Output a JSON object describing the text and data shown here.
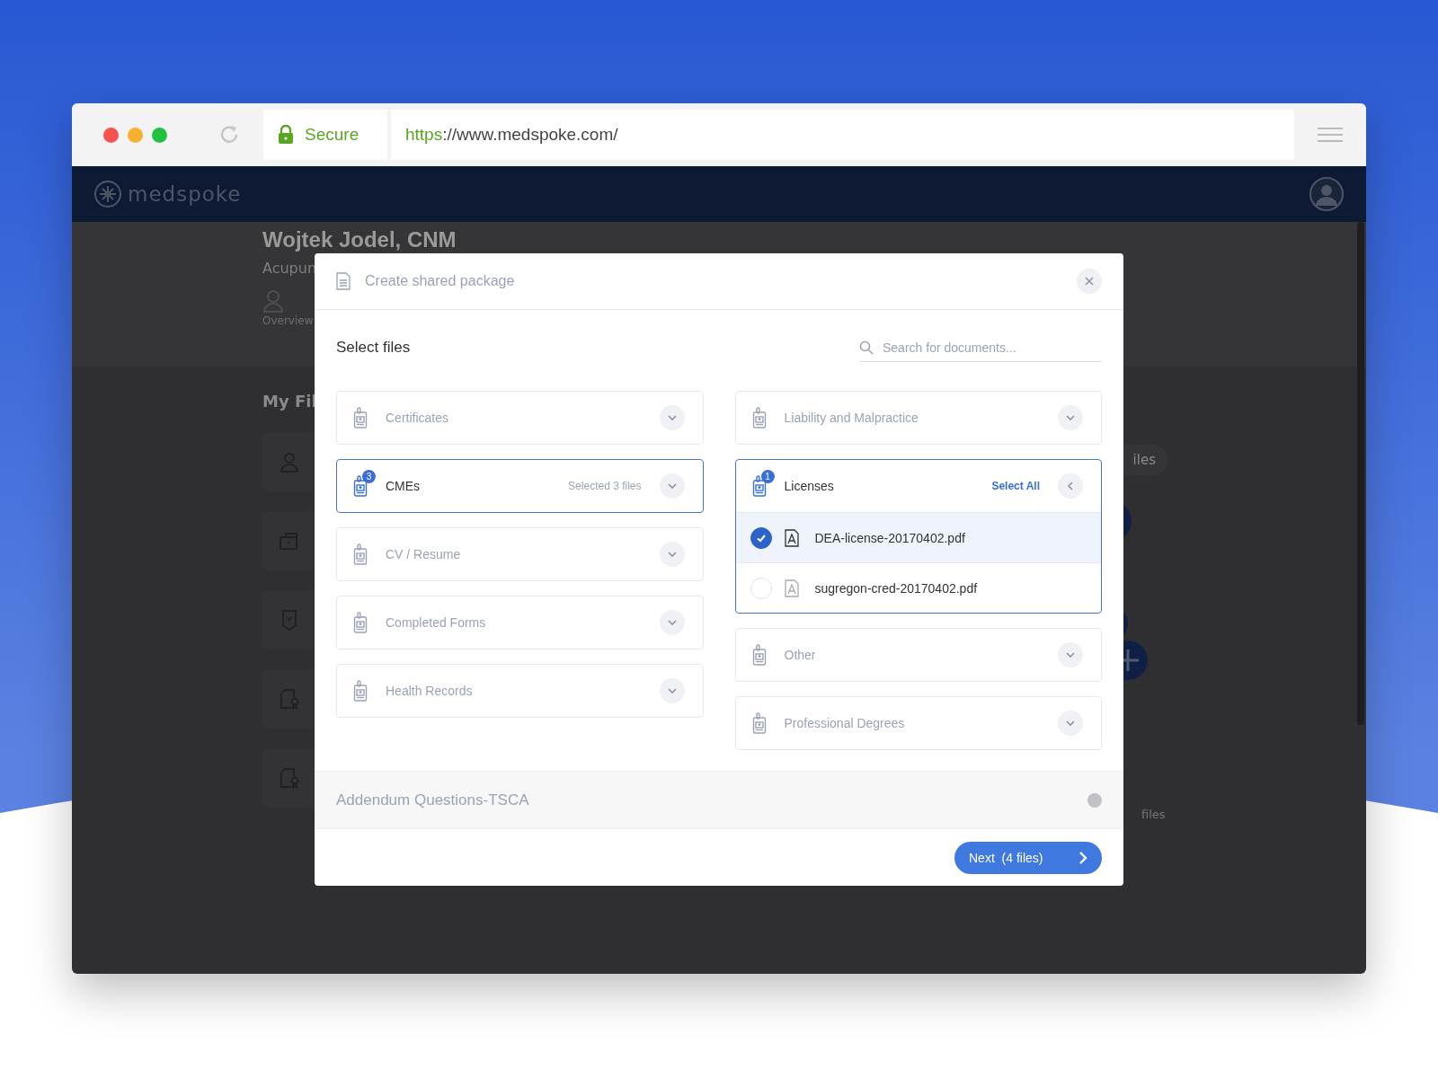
{
  "browser": {
    "secure_label": "Secure",
    "url_scheme": "https",
    "url_rest": "://www.medspoke.com/"
  },
  "app": {
    "logo": "medspoke"
  },
  "profile": {
    "name": "Wojtek Jodel, CNM",
    "subtitle": "Acupun",
    "tab": "Overview"
  },
  "files_section": {
    "title": "My Fil",
    "cards": [
      {
        "kind": "person"
      },
      {
        "kind": "kit"
      },
      {
        "kind": "shield"
      },
      {
        "kind": "award"
      },
      {
        "kind": "award"
      }
    ],
    "right_pill": "iles",
    "right_note": "files"
  },
  "modal": {
    "title": "Create shared package",
    "section_title": "Select files",
    "search": {
      "placeholder": "Search for documents..."
    },
    "left_categories": [
      {
        "label": "Certificates",
        "active": false,
        "expanded": false
      },
      {
        "label": "CMEs",
        "active": true,
        "expanded": false,
        "badge": "3",
        "note": "Selected 3 files"
      },
      {
        "label": "CV / Resume",
        "active": false,
        "expanded": false
      },
      {
        "label": "Completed Forms",
        "active": false,
        "expanded": false
      },
      {
        "label": "Health Records",
        "active": false,
        "expanded": false
      }
    ],
    "right_categories": [
      {
        "label": "Liability and Malpractice",
        "active": false,
        "expanded": false
      },
      {
        "label": "Licenses",
        "active": true,
        "expanded": true,
        "badge": "1",
        "select_all": "Select All",
        "files": [
          {
            "name": "DEA-license-20170402.pdf",
            "selected": true
          },
          {
            "name": "sugregon-cred-20170402.pdf",
            "selected": false
          }
        ]
      },
      {
        "label": "Other",
        "active": false,
        "expanded": false
      },
      {
        "label": "Professional Degrees",
        "active": false,
        "expanded": false
      }
    ],
    "footer_item": {
      "label": "Addendum Questions-TSCA",
      "on": false
    },
    "next_button": "Next  (4 files)"
  }
}
